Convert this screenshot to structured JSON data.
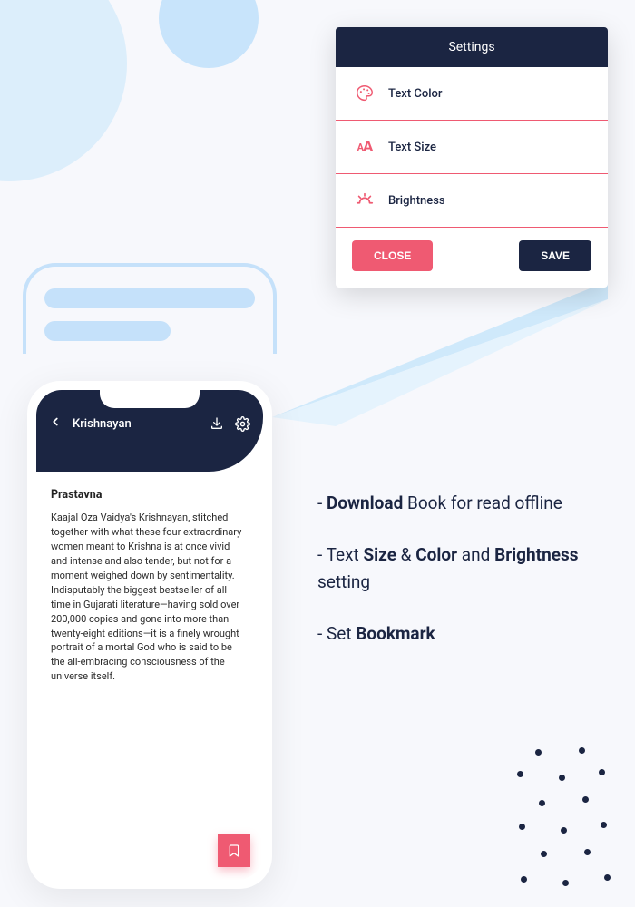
{
  "reader": {
    "book_title": "Krishnayan",
    "chapter_title": "Prastavna",
    "chapter_text": "Kaajal Oza Vaidya's Krishnayan, stitched together with what these four extraordinary women meant to Krishna is at once vivid and intense and also tender, but not for a moment weighed down by sentimentality. Indisputably the biggest bestseller of all time in Gujarati literature—having sold over 200,000 copies and gone into more than twenty-eight editions—it is a finely wrought portrait of a mortal God who is said to be the all-embracing consciousness of the universe itself."
  },
  "settings": {
    "title": "Settings",
    "rows": {
      "text_color": "Text Color",
      "text_size": "Text Size",
      "brightness": "Brightness"
    },
    "close_label": "CLOSE",
    "save_label": "SAVE"
  },
  "features": {
    "f1_pre": "- ",
    "f1_bold": "Download",
    "f1_post": " Book for read offline",
    "f2_pre": "- Text ",
    "f2_b1": "Size",
    "f2_mid1": " & ",
    "f2_b2": "Color",
    "f2_mid2": " and ",
    "f2_b3": "Brightness",
    "f2_post": " setting",
    "f3_pre": "- Set ",
    "f3_bold": "Bookmark"
  }
}
